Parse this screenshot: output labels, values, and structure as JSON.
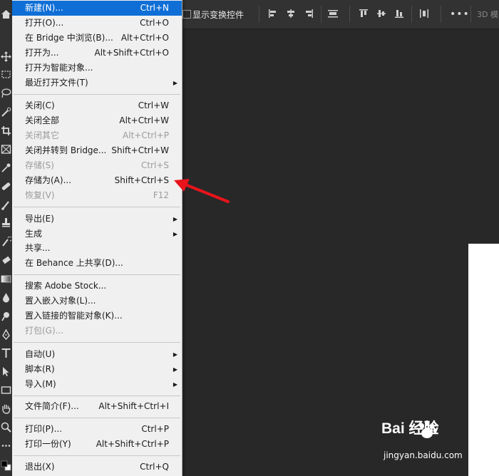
{
  "options_bar": {
    "show_transform_controls": "显示变换控件",
    "more_label": "•••",
    "mode_3d_label": "3D 模"
  },
  "file_menu": {
    "items": [
      {
        "label": "新建(N)...",
        "shortcut": "Ctrl+N",
        "state": "highlighted"
      },
      {
        "label": "打开(O)...",
        "shortcut": "Ctrl+O"
      },
      {
        "label": "在 Bridge 中浏览(B)...",
        "shortcut": "Alt+Ctrl+O"
      },
      {
        "label": "打开为...",
        "shortcut": "Alt+Shift+Ctrl+O"
      },
      {
        "label": "打开为智能对象..."
      },
      {
        "label": "最近打开文件(T)",
        "submenu": true
      },
      {
        "label": "关闭(C)",
        "shortcut": "Ctrl+W"
      },
      {
        "label": "关闭全部",
        "shortcut": "Alt+Ctrl+W"
      },
      {
        "label": "关闭其它",
        "shortcut": "Alt+Ctrl+P",
        "state": "disabled"
      },
      {
        "label": "关闭并转到 Bridge...",
        "shortcut": "Shift+Ctrl+W"
      },
      {
        "label": "存储(S)",
        "shortcut": "Ctrl+S",
        "state": "disabled"
      },
      {
        "label": "存储为(A)...",
        "shortcut": "Shift+Ctrl+S"
      },
      {
        "label": "恢复(V)",
        "shortcut": "F12",
        "state": "disabled"
      },
      {
        "label": "导出(E)",
        "submenu": true
      },
      {
        "label": "生成",
        "submenu": true
      },
      {
        "label": "共享..."
      },
      {
        "label": "在 Behance 上共享(D)..."
      },
      {
        "label": "搜索 Adobe Stock..."
      },
      {
        "label": "置入嵌入对象(L)..."
      },
      {
        "label": "置入链接的智能对象(K)..."
      },
      {
        "label": "打包(G)...",
        "state": "disabled"
      },
      {
        "label": "自动(U)",
        "submenu": true
      },
      {
        "label": "脚本(R)",
        "submenu": true
      },
      {
        "label": "导入(M)",
        "submenu": true
      },
      {
        "label": "文件简介(F)...",
        "shortcut": "Alt+Shift+Ctrl+I"
      },
      {
        "label": "打印(P)...",
        "shortcut": "Ctrl+P"
      },
      {
        "label": "打印一份(Y)",
        "shortcut": "Alt+Shift+Ctrl+P"
      },
      {
        "label": "退出(X)",
        "shortcut": "Ctrl+Q"
      }
    ]
  },
  "watermark": {
    "brand": "Bai 经验",
    "url": "jingyan.baidu.com"
  }
}
